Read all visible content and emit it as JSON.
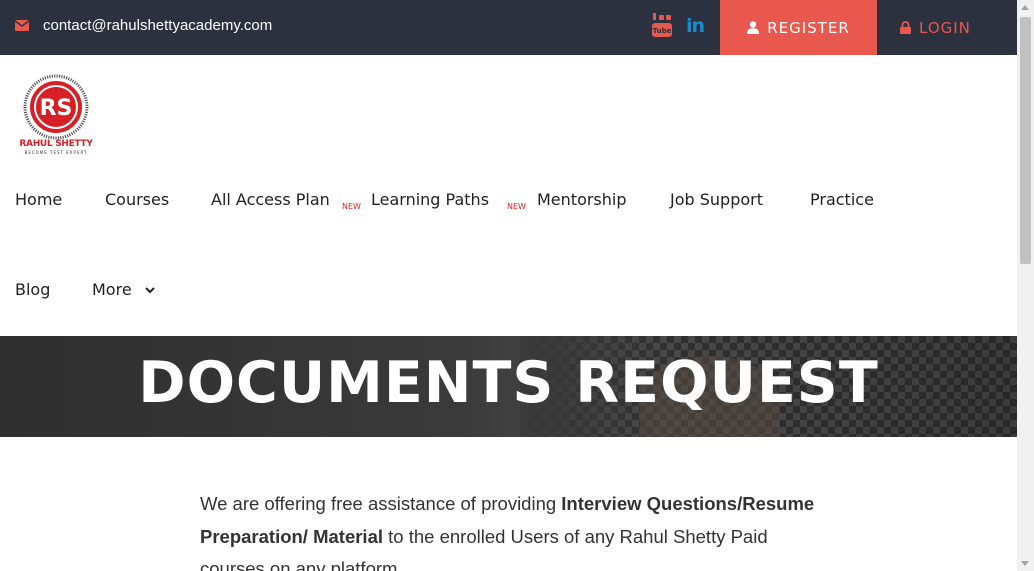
{
  "topbar": {
    "email": "contact@rahulshettyacademy.com",
    "register_label": "REGISTER",
    "login_label": "LOGIN",
    "youtube_icon": "youtube-icon",
    "linkedin_icon": "linkedin-icon",
    "linkedin_glyph": "in"
  },
  "logo": {
    "name": "RAHUL SHETTY",
    "tagline": "BECOME TEST EXPERT"
  },
  "nav": {
    "items": [
      {
        "label": "Home"
      },
      {
        "label": "Courses"
      },
      {
        "label": "All Access Plan"
      },
      {
        "label": "Learning Paths"
      },
      {
        "label": "Mentorship"
      },
      {
        "label": "Job Support"
      },
      {
        "label": "Practice"
      },
      {
        "label": "Blog"
      },
      {
        "label": "More"
      }
    ],
    "new_badge": "NEW"
  },
  "banner": {
    "title": "DOCUMENTS REQUEST"
  },
  "content": {
    "intro_1": "We are offering free assistance of providing ",
    "intro_bold": "Interview Questions/Resume Preparation/ Material",
    "intro_2": " to the enrolled Users of any Rahul Shetty Paid courses on any platform."
  },
  "colors": {
    "topbar_bg": "#2b313f",
    "accent": "#e9584f",
    "brand_red": "#d71f26",
    "linkedin": "#1a8bd0"
  }
}
